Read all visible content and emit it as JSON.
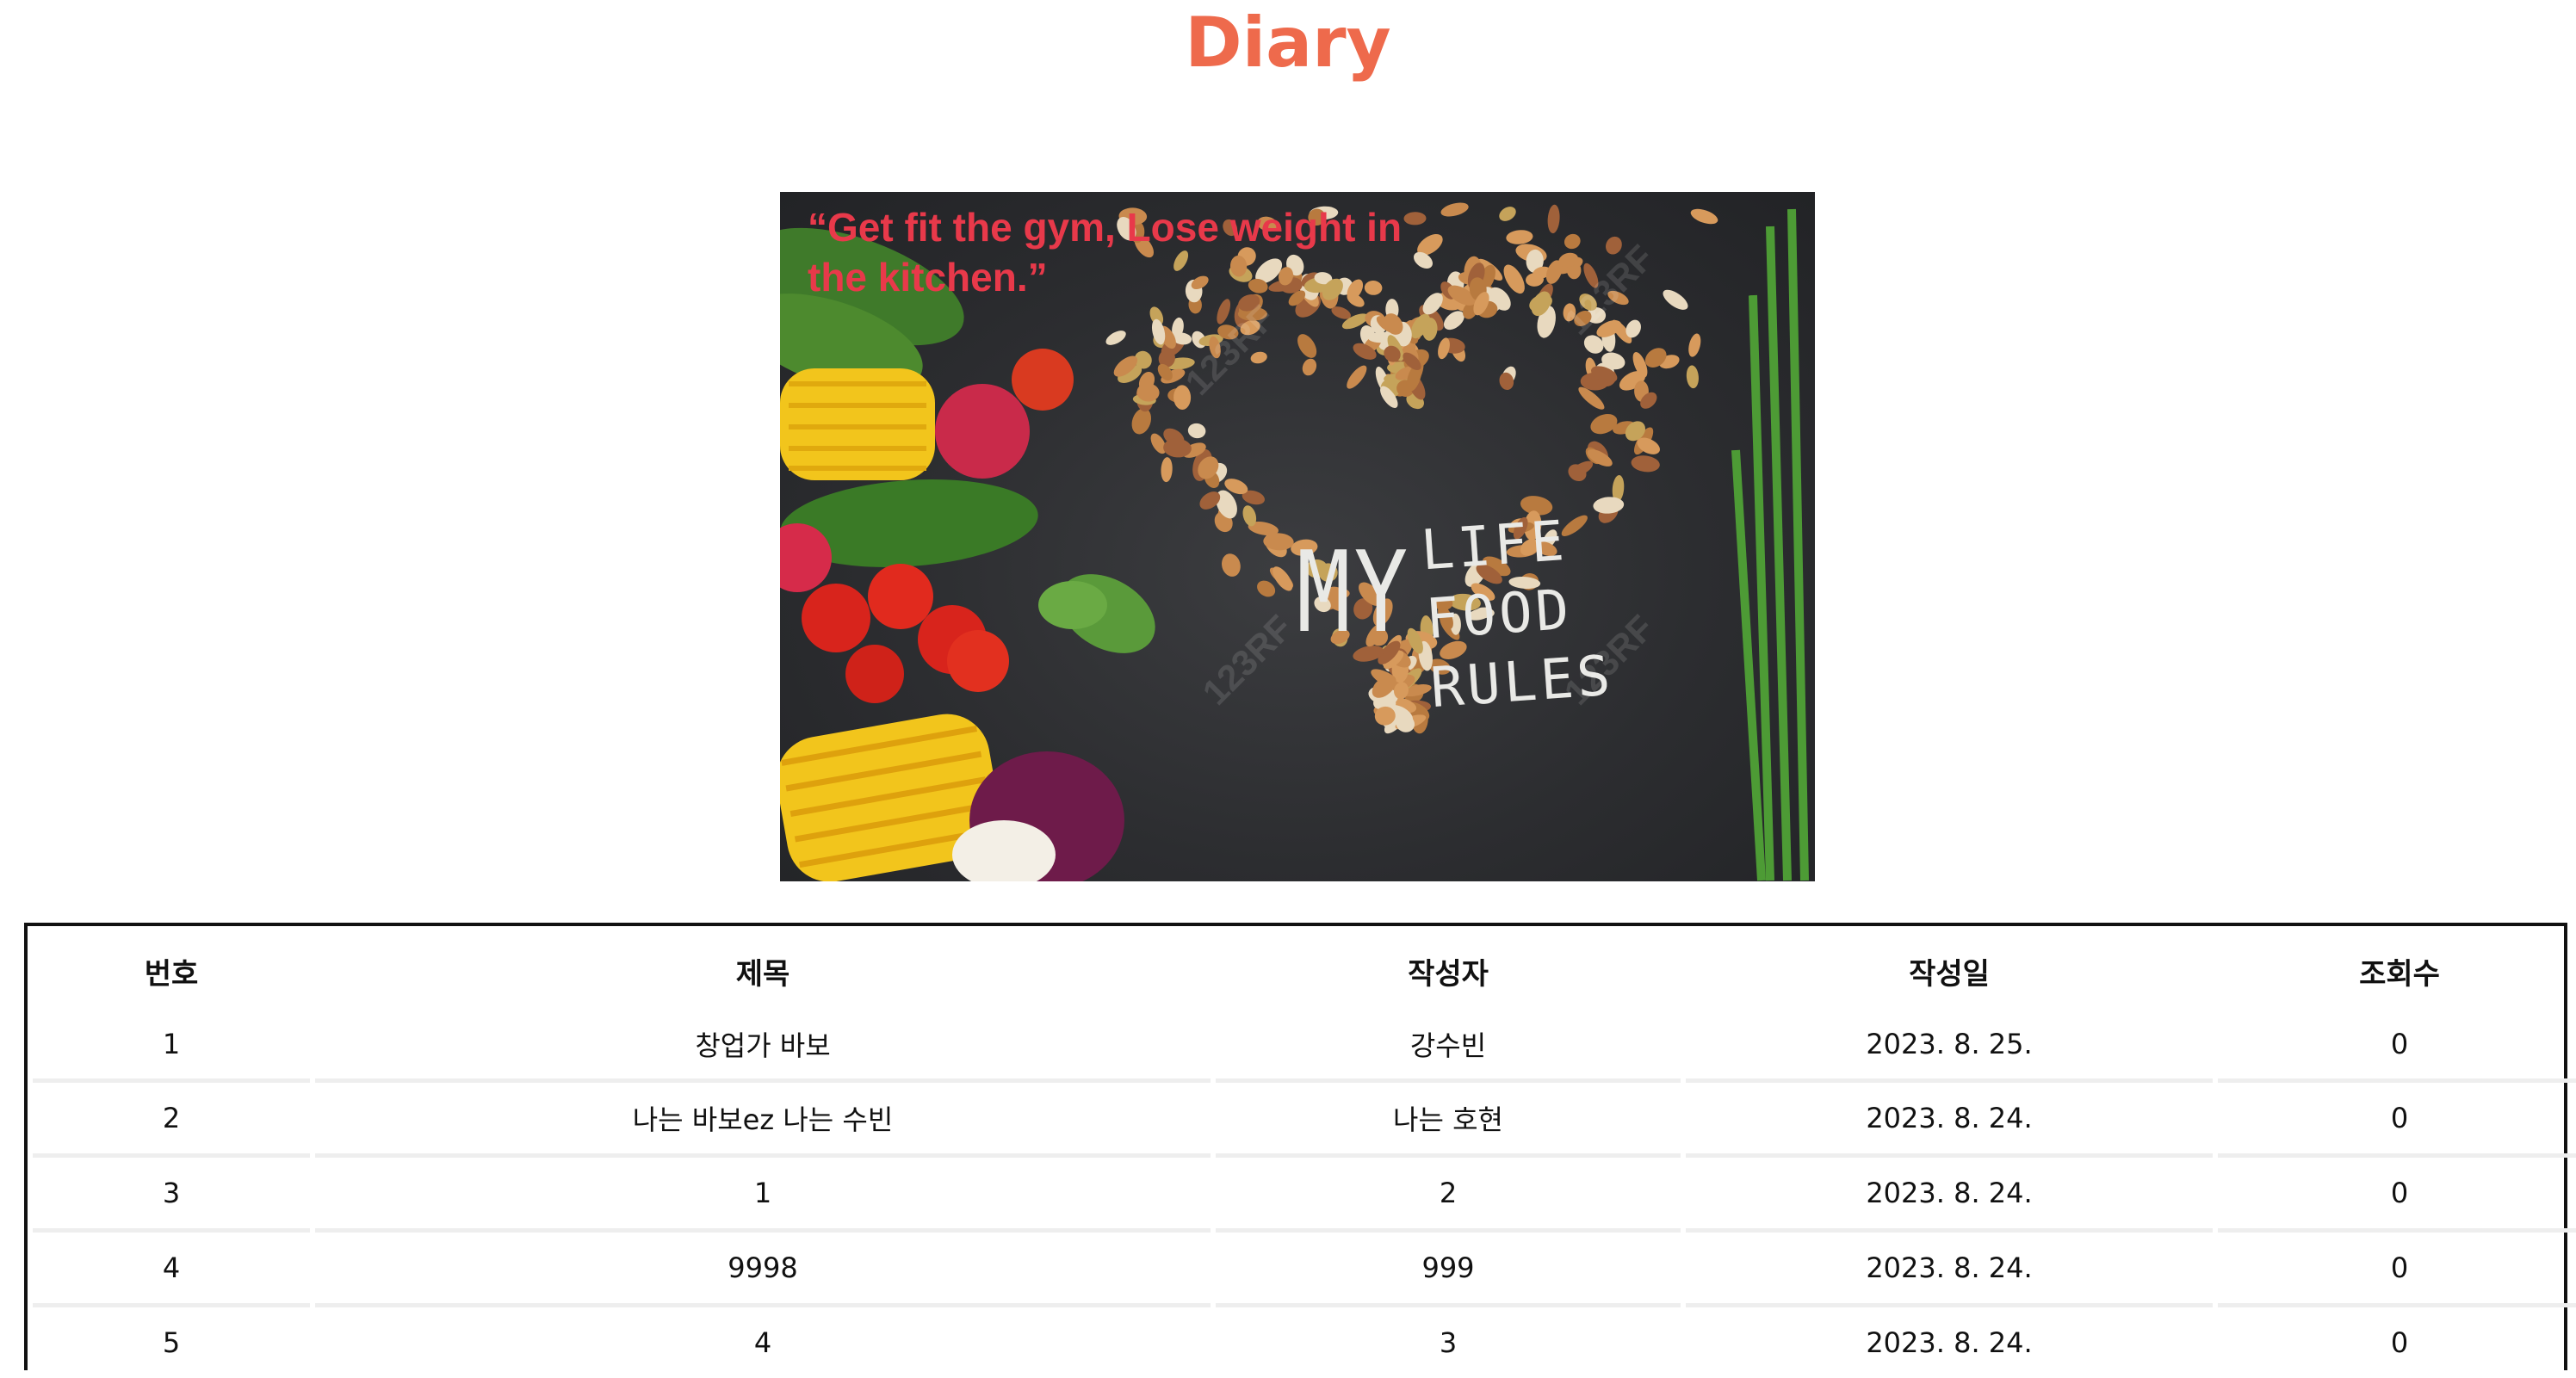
{
  "header": {
    "title": "Diary"
  },
  "hero": {
    "quote": "“Get fit the gym, Lose weight in the kitchen.”",
    "chalk_my": "MY",
    "chalk_lines": [
      "LIFE",
      "FOOD",
      "RULES"
    ],
    "watermark": "123RF"
  },
  "board": {
    "columns": [
      "번호",
      "제목",
      "작성자",
      "작성일",
      "조회수"
    ],
    "rows": [
      {
        "no": "1",
        "title": "창업가 바보",
        "author": "강수빈",
        "date": "2023. 8. 25.",
        "views": "0"
      },
      {
        "no": "2",
        "title": "나는 바보ez 나는 수빈",
        "author": "나는 호현",
        "date": "2023. 8. 24.",
        "views": "0"
      },
      {
        "no": "3",
        "title": "1",
        "author": "2",
        "date": "2023. 8. 24.",
        "views": "0"
      },
      {
        "no": "4",
        "title": "9998",
        "author": "999",
        "date": "2023. 8. 24.",
        "views": "0"
      },
      {
        "no": "5",
        "title": "4",
        "author": "3",
        "date": "2023. 8. 24.",
        "views": "0"
      }
    ]
  },
  "colors": {
    "title": "#ee6a4c",
    "quote": "#e8394a",
    "board_border": "#111111"
  }
}
